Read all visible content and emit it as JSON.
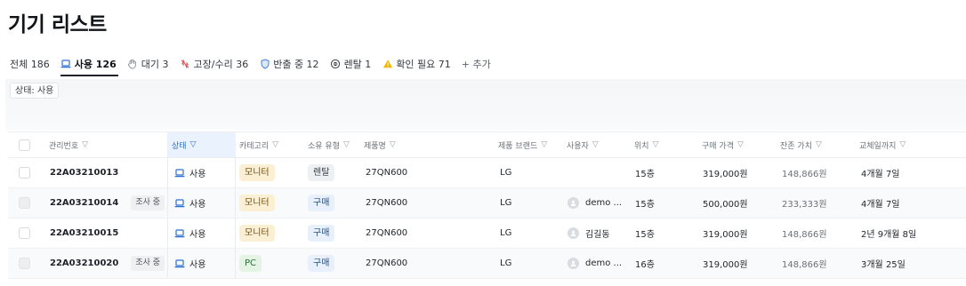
{
  "page": {
    "title": "기기 리스트"
  },
  "tabs": [
    {
      "label": "전체 186",
      "icon": "none",
      "active": false
    },
    {
      "label": "사용 126",
      "icon": "laptop-icon",
      "active": true
    },
    {
      "label": "대기 3",
      "icon": "hand-icon",
      "active": false
    },
    {
      "label": "고장/수리 36",
      "icon": "broken-icon",
      "active": false
    },
    {
      "label": "반출 중 12",
      "icon": "shield-icon",
      "active": false
    },
    {
      "label": "렌탈 1",
      "icon": "rental-icon",
      "active": false
    },
    {
      "label": "확인 필요 71",
      "icon": "warning-icon",
      "active": false
    },
    {
      "label": "+ 추가",
      "icon": "none",
      "active": false
    }
  ],
  "filter": {
    "chip": "상태: 사용"
  },
  "table": {
    "headers": {
      "serial": "관리번호",
      "status": "상태",
      "category": "카테고리",
      "ownership": "소유 유형",
      "product": "제품명",
      "brand": "제품 브랜드",
      "user": "사용자",
      "location": "위치",
      "price": "구매 가격",
      "residual": "잔존 가치",
      "replace": "교체일까지"
    },
    "rows": [
      {
        "serial": "22A03210013",
        "survey": "",
        "status": "사용",
        "category": "모니터",
        "category_type": "monitor",
        "ownership": "렌탈",
        "ownership_type": "rent",
        "product": "27QN600",
        "brand": "LG",
        "user": "",
        "location": "15층",
        "price": "319,000원",
        "residual": "148,866원",
        "replace": "4개월 7일"
      },
      {
        "serial": "22A03210014",
        "survey": "조사 중",
        "status": "사용",
        "category": "모니터",
        "category_type": "monitor",
        "ownership": "구매",
        "ownership_type": "buy",
        "product": "27QN600",
        "brand": "LG",
        "user": "demo ...",
        "location": "15층",
        "price": "500,000원",
        "residual": "233,333원",
        "replace": "4개월 7일"
      },
      {
        "serial": "22A03210015",
        "survey": "",
        "status": "사용",
        "category": "모니터",
        "category_type": "monitor",
        "ownership": "구매",
        "ownership_type": "buy",
        "product": "27QN600",
        "brand": "LG",
        "user": "김길동",
        "location": "15층",
        "price": "319,000원",
        "residual": "148,866원",
        "replace": "2년 9개월 8일"
      },
      {
        "serial": "22A03210020",
        "survey": "조사 중",
        "status": "사용",
        "category": "PC",
        "category_type": "pc",
        "ownership": "구매",
        "ownership_type": "buy",
        "product": "27QN600",
        "brand": "LG",
        "user": "demo ...",
        "location": "16층",
        "price": "319,000원",
        "residual": "148,866원",
        "replace": "3개월 25일"
      }
    ]
  },
  "colors": {
    "accent": "#2d6fd1",
    "active_tab": "#1f2329",
    "monitor_pill": "#fbf0d4",
    "pc_pill": "#e3f4e4",
    "warning": "#f2b600",
    "broken": "#e5484d"
  }
}
